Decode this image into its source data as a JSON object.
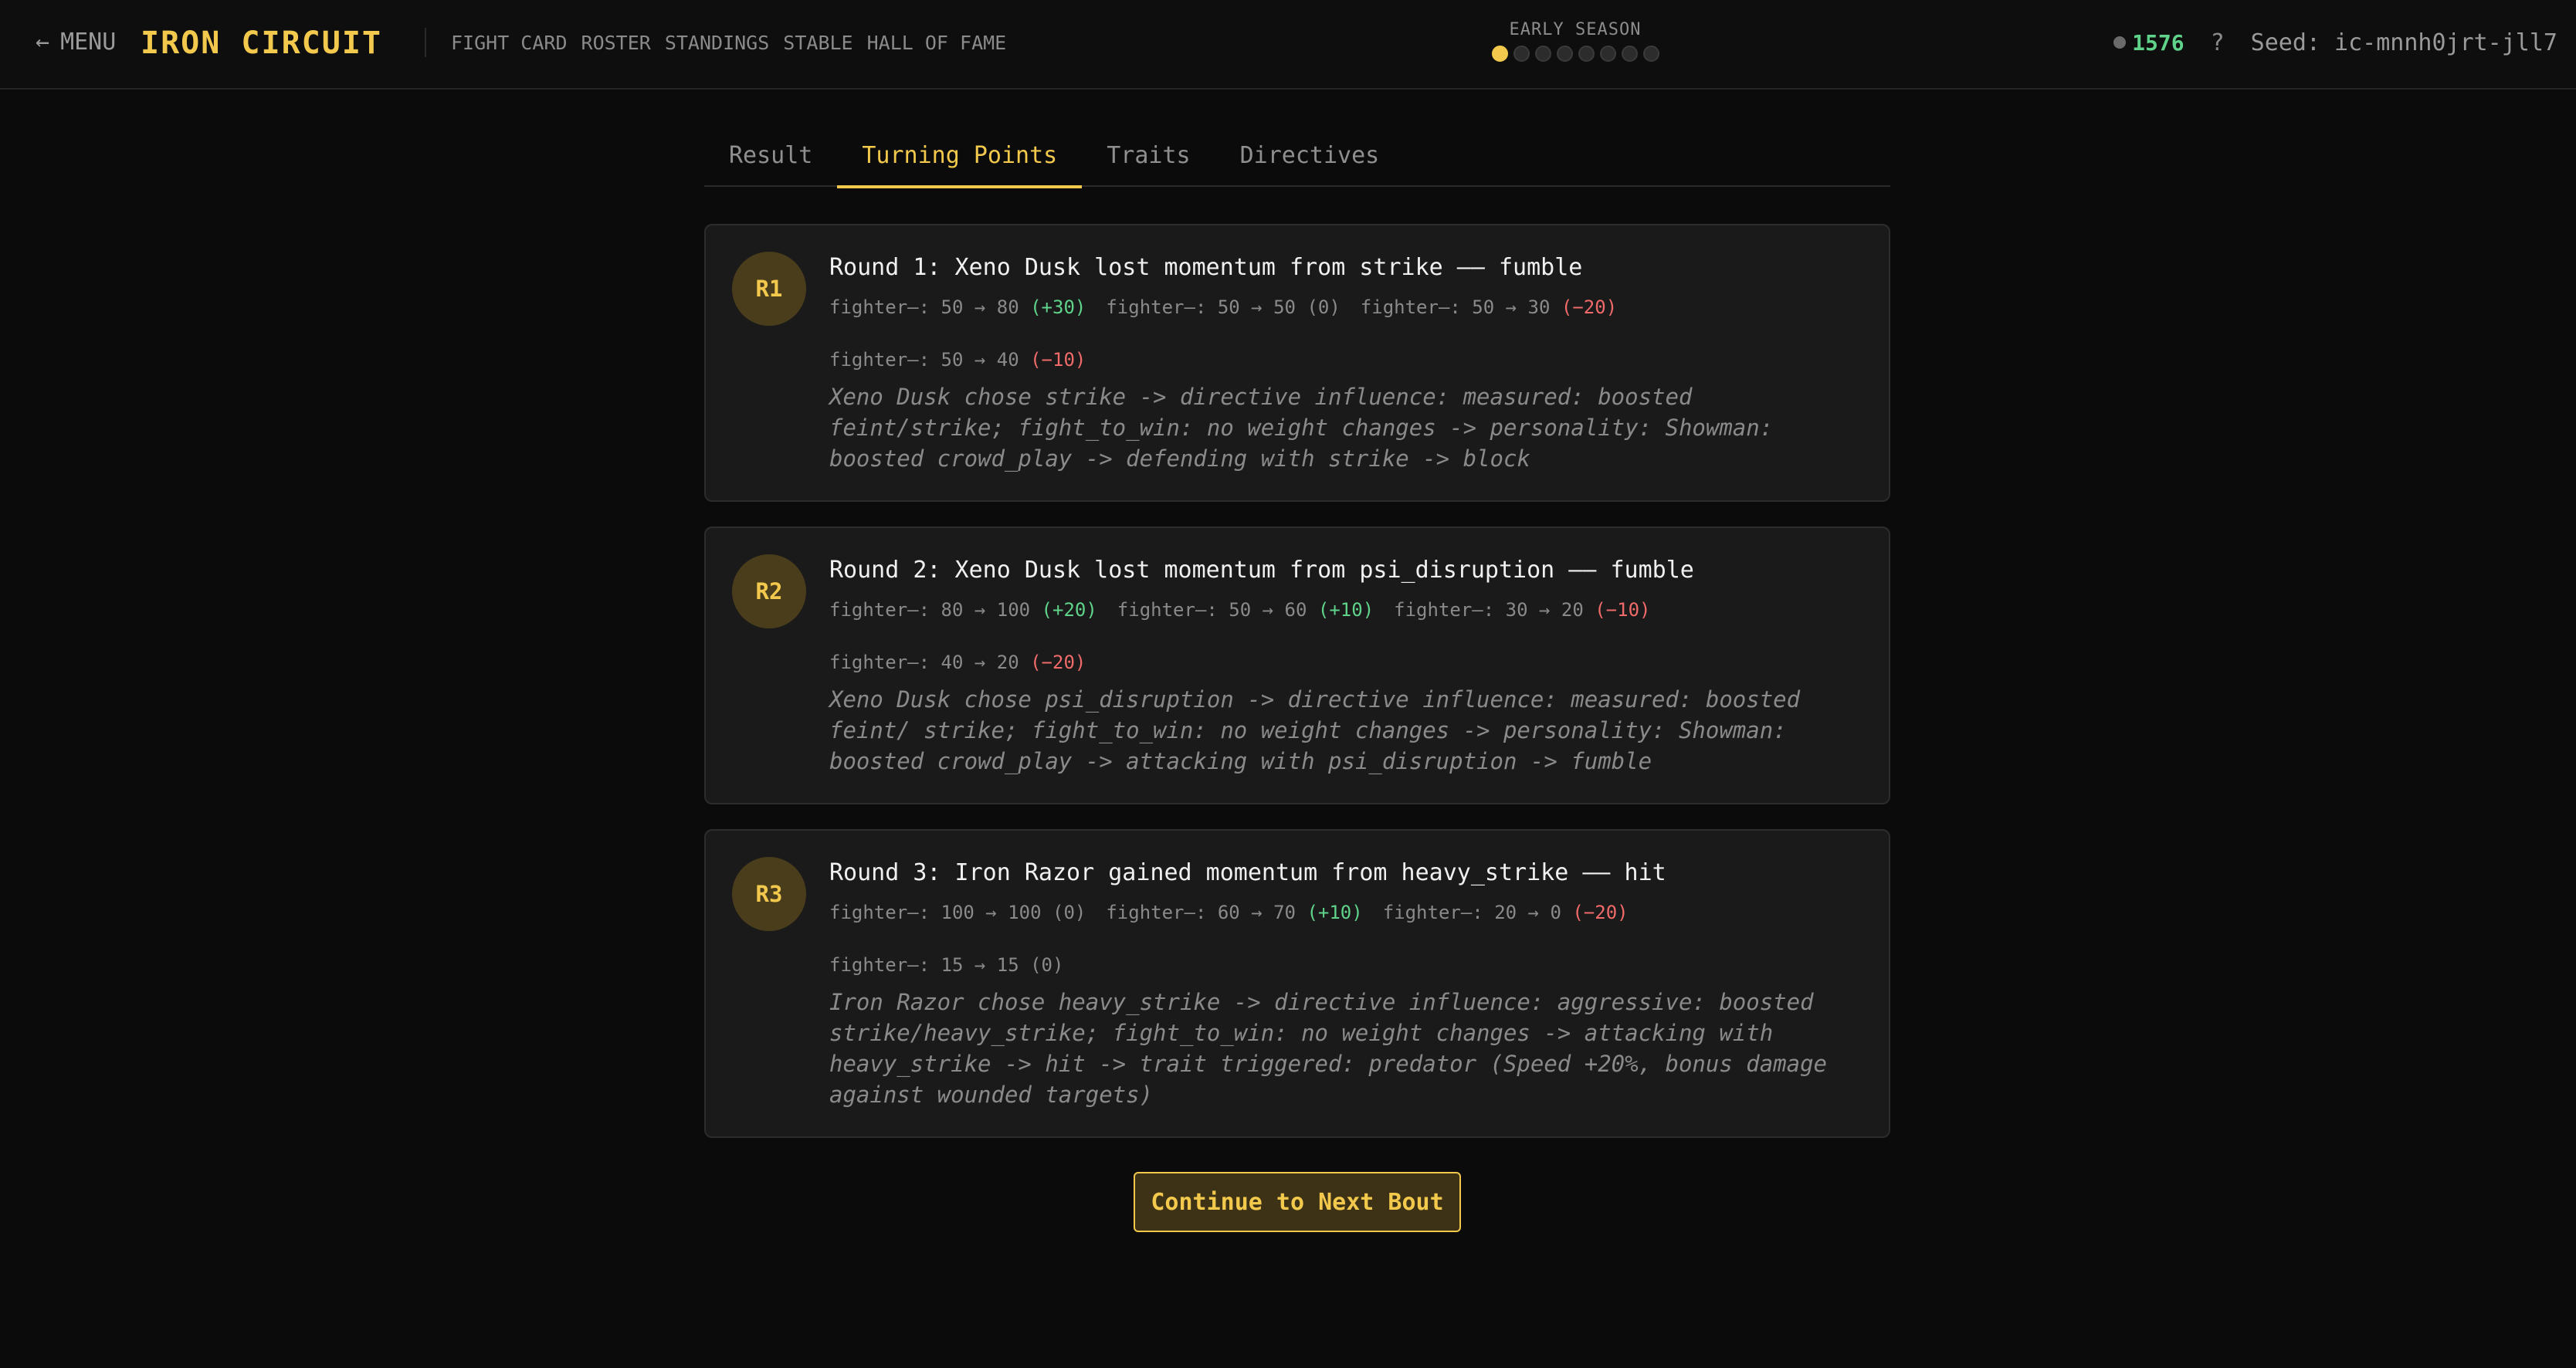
{
  "header": {
    "menu_arrow": "←",
    "menu_label": "MENU",
    "brand": "IRON CIRCUIT",
    "nav": [
      "FIGHT CARD",
      "ROSTER",
      "STANDINGS",
      "STABLE",
      "HALL OF FAME"
    ],
    "season_label": "EARLY SEASON",
    "season_progress": {
      "current": 1,
      "total": 8
    },
    "credits": "1576",
    "help": "?",
    "seed": "Seed: ic-mnnh0jrt-jll7"
  },
  "tabs": [
    {
      "label": "Result",
      "active": false
    },
    {
      "label": "Turning Points",
      "active": true
    },
    {
      "label": "Traits",
      "active": false
    },
    {
      "label": "Directives",
      "active": false
    }
  ],
  "rounds": [
    {
      "badge": "R1",
      "title": "Round 1: Xeno Dusk lost momentum from strike —— fumble",
      "deltas": [
        {
          "label": "fighter—: 50 → 80",
          "change": "(+30)",
          "tone": "pos"
        },
        {
          "label": "fighter—: 50 → 50",
          "change": "(0)",
          "tone": "neu"
        },
        {
          "label": "fighter—: 50 → 30",
          "change": "(−20)",
          "tone": "neg"
        },
        {
          "label": "fighter—: 50 → 40",
          "change": "(−10)",
          "tone": "neg"
        }
      ],
      "description": "Xeno Dusk chose strike -> directive influence: measured: boosted feint/strike; fight_to_win: no weight changes -> personality: Showman: boosted crowd_play -> defending with strike -> block"
    },
    {
      "badge": "R2",
      "title": "Round 2: Xeno Dusk lost momentum from psi_disruption —— fumble",
      "deltas": [
        {
          "label": "fighter—: 80 → 100",
          "change": "(+20)",
          "tone": "pos"
        },
        {
          "label": "fighter—: 50 → 60",
          "change": "(+10)",
          "tone": "pos"
        },
        {
          "label": "fighter—: 30 → 20",
          "change": "(−10)",
          "tone": "neg"
        },
        {
          "label": "fighter—: 40 → 20",
          "change": "(−20)",
          "tone": "neg"
        }
      ],
      "description": "Xeno Dusk chose psi_disruption -> directive influence: measured: boosted feint/ strike; fight_to_win: no weight changes -> personality: Showman: boosted crowd_play -> attacking with psi_disruption -> fumble"
    },
    {
      "badge": "R3",
      "title": "Round 3: Iron Razor gained momentum from heavy_strike —— hit",
      "deltas": [
        {
          "label": "fighter—: 100 → 100",
          "change": "(0)",
          "tone": "neu"
        },
        {
          "label": "fighter—: 60 → 70",
          "change": "(+10)",
          "tone": "pos"
        },
        {
          "label": "fighter—: 20 → 0",
          "change": "(−20)",
          "tone": "neg"
        },
        {
          "label": "fighter—: 15 → 15",
          "change": "(0)",
          "tone": "neu"
        }
      ],
      "description": "Iron Razor chose heavy_strike -> directive influence: aggressive: boosted strike/heavy_strike; fight_to_win: no weight changes -> attacking with heavy_strike -> hit -> trait triggered: predator (Speed +20%, bonus damage against wounded targets)"
    }
  ],
  "continue_label": "Continue to Next Bout",
  "colors": {
    "accent": "#f2c94c",
    "positive": "#5fd38a",
    "negative": "#f06a6a"
  }
}
